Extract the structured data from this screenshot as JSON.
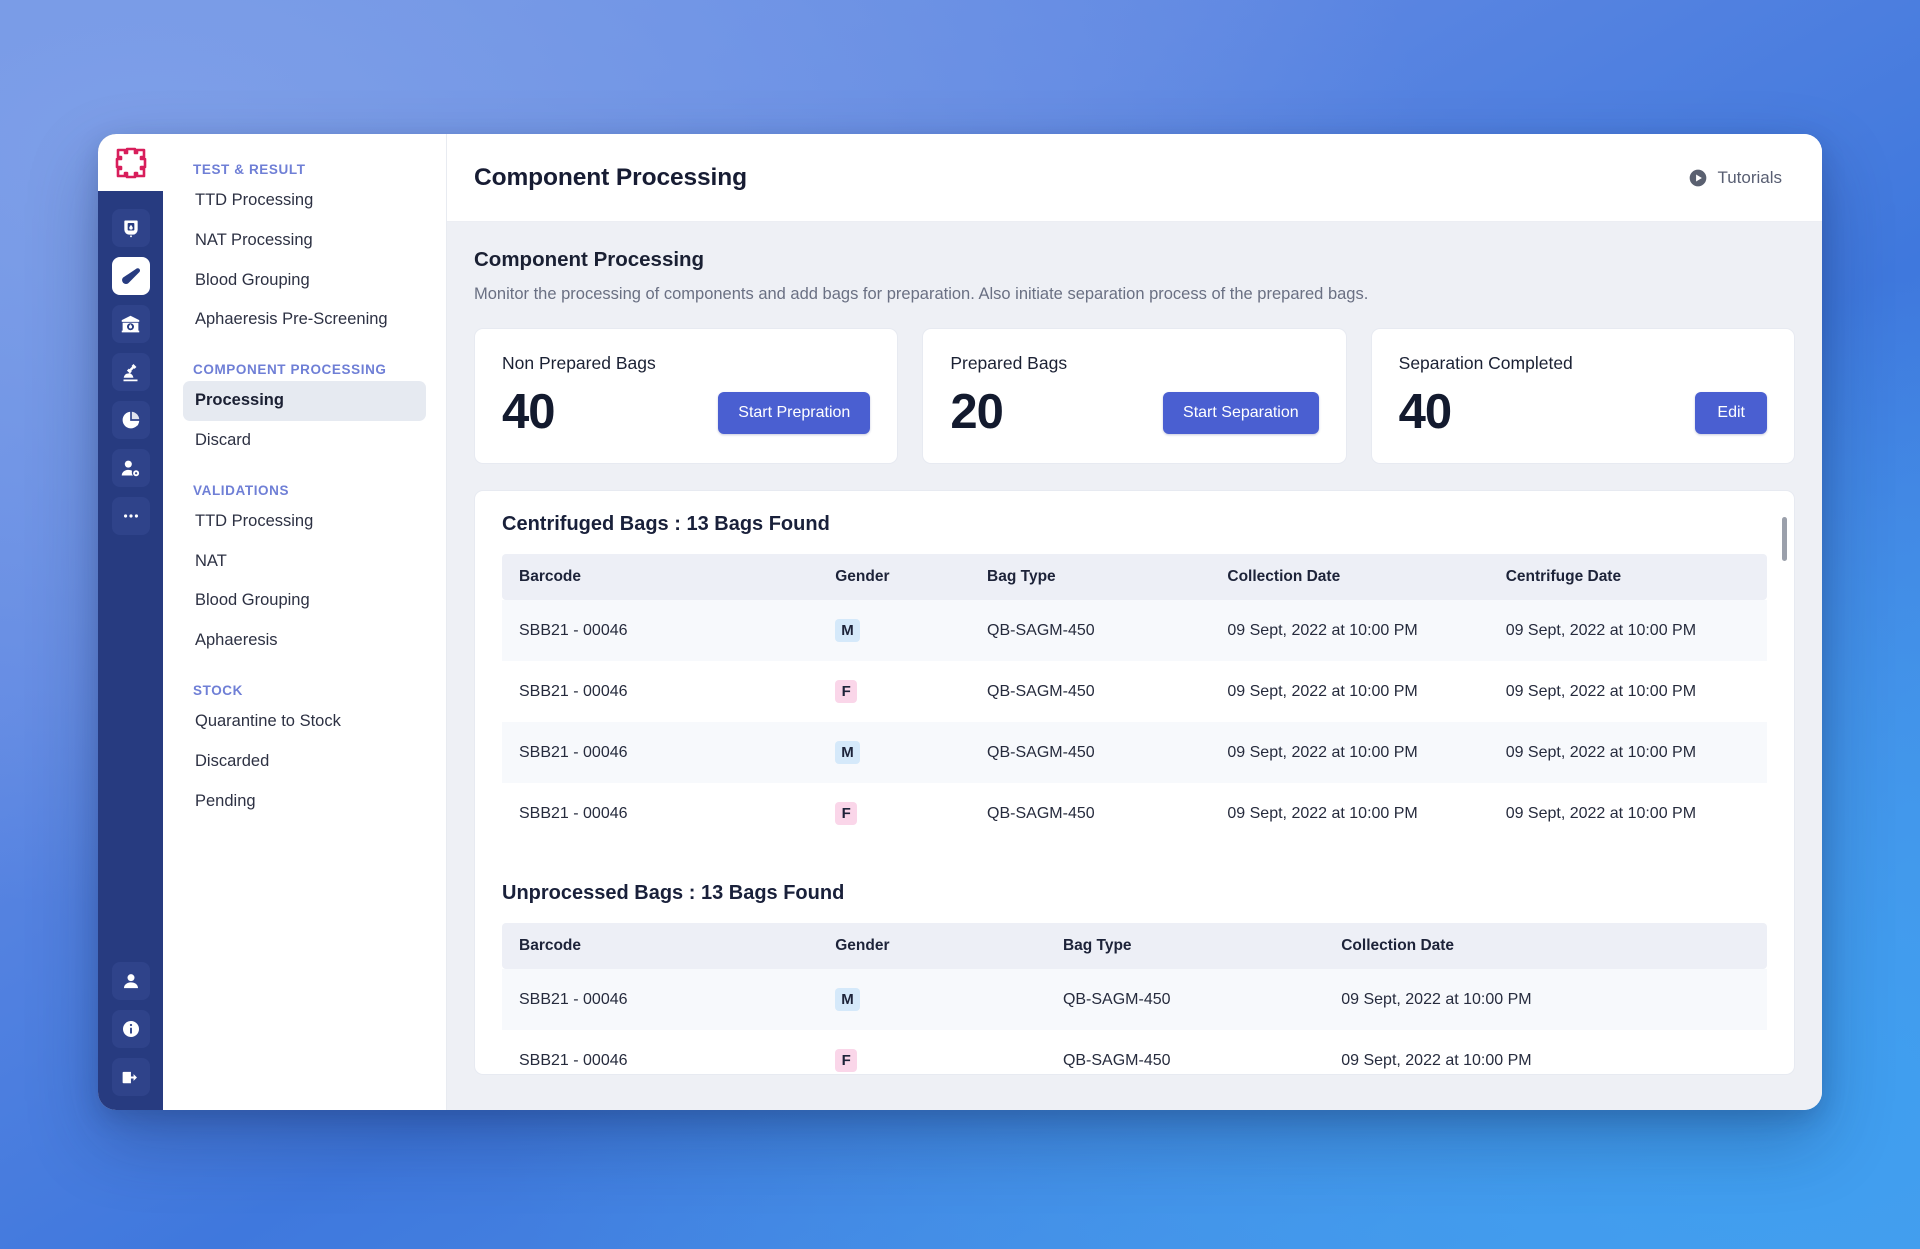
{
  "window": {
    "logo_icon": "medical-cross-logo"
  },
  "icon_rail": {
    "top_items": [
      {
        "name": "blood-bag-icon",
        "active": false
      },
      {
        "name": "test-tube-icon",
        "active": true
      },
      {
        "name": "blood-bank-icon",
        "active": false
      },
      {
        "name": "microscope-icon",
        "active": false
      },
      {
        "name": "pie-chart-icon",
        "active": false
      },
      {
        "name": "user-settings-icon",
        "active": false
      },
      {
        "name": "more-dots-icon",
        "active": false
      }
    ],
    "bottom_items": [
      {
        "name": "profile-icon"
      },
      {
        "name": "info-icon"
      },
      {
        "name": "logout-icon"
      }
    ]
  },
  "sidebar": {
    "sections": [
      {
        "title": "TEST & RESULT",
        "items": [
          {
            "label": "TTD Processing",
            "active": false
          },
          {
            "label": "NAT Processing",
            "active": false
          },
          {
            "label": "Blood Grouping",
            "active": false
          },
          {
            "label": "Aphaeresis Pre-Screening",
            "active": false
          }
        ]
      },
      {
        "title": "COMPONENT PROCESSING",
        "items": [
          {
            "label": "Processing",
            "active": true
          },
          {
            "label": "Discard",
            "active": false
          }
        ]
      },
      {
        "title": "VALIDATIONS",
        "items": [
          {
            "label": "TTD Processing",
            "active": false
          },
          {
            "label": "NAT",
            "active": false
          },
          {
            "label": "Blood Grouping",
            "active": false
          },
          {
            "label": "Aphaeresis",
            "active": false
          }
        ]
      },
      {
        "title": "STOCK",
        "items": [
          {
            "label": "Quarantine to Stock",
            "active": false
          },
          {
            "label": "Discarded",
            "active": false
          },
          {
            "label": "Pending",
            "active": false
          }
        ]
      }
    ]
  },
  "topbar": {
    "title": "Component Processing",
    "tutorials_label": "Tutorials",
    "tutorials_icon": "play-circle-icon"
  },
  "section": {
    "title": "Component Processing",
    "subtitle": "Monitor the processing of components and add bags for preparation. Also initiate separation process of the prepared bags."
  },
  "stats": [
    {
      "label": "Non Prepared Bags",
      "value": "40",
      "button": "Start Prepration"
    },
    {
      "label": "Prepared Bags",
      "value": "20",
      "button": "Start Separation"
    },
    {
      "label": "Separation Completed",
      "value": "40",
      "button": "Edit"
    }
  ],
  "tables": {
    "centrifuged": {
      "title": "Centrifuged Bags : 13 Bags Found",
      "columns": [
        "Barcode",
        "Gender",
        "Bag Type",
        "Collection Date",
        "Centrifuge Date"
      ],
      "rows": [
        {
          "barcode": "SBB21 - 00046",
          "gender": "M",
          "bag_type": "QB-SAGM-450",
          "collection_date": "09 Sept, 2022 at 10:00 PM",
          "centrifuge_date": "09 Sept, 2022 at 10:00 PM"
        },
        {
          "barcode": "SBB21 - 00046",
          "gender": "F",
          "bag_type": "QB-SAGM-450",
          "collection_date": "09 Sept, 2022 at 10:00 PM",
          "centrifuge_date": "09 Sept, 2022 at 10:00 PM"
        },
        {
          "barcode": "SBB21 - 00046",
          "gender": "M",
          "bag_type": "QB-SAGM-450",
          "collection_date": "09 Sept, 2022 at 10:00 PM",
          "centrifuge_date": "09 Sept, 2022 at 10:00 PM"
        },
        {
          "barcode": "SBB21 - 00046",
          "gender": "F",
          "bag_type": "QB-SAGM-450",
          "collection_date": "09 Sept, 2022 at 10:00 PM",
          "centrifuge_date": "09 Sept, 2022 at 10:00 PM"
        }
      ]
    },
    "unprocessed": {
      "title": "Unprocessed Bags : 13 Bags Found",
      "columns": [
        "Barcode",
        "Gender",
        "Bag Type",
        "Collection Date"
      ],
      "rows": [
        {
          "barcode": "SBB21 - 00046",
          "gender": "M",
          "bag_type": "QB-SAGM-450",
          "collection_date": "09 Sept, 2022 at 10:00 PM"
        },
        {
          "barcode": "SBB21 - 00046",
          "gender": "F",
          "bag_type": "QB-SAGM-450",
          "collection_date": "09 Sept, 2022 at 10:00 PM"
        }
      ]
    }
  },
  "colors": {
    "accent_blue": "#4a5fd1",
    "rail_navy": "#273b80",
    "logo_crimson": "#d81e5b",
    "section_heading": "#6f7fd6",
    "badge_male": "#d5e9fa",
    "badge_female": "#fad6e9"
  }
}
